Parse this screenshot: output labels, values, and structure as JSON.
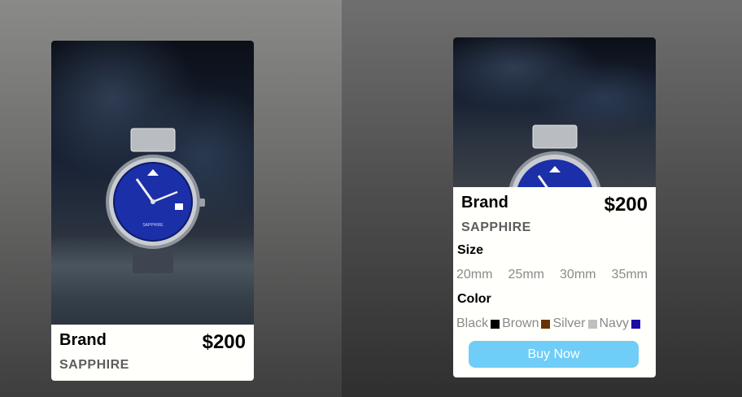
{
  "cards": [
    {
      "brand": "Brand",
      "price": "$200",
      "subtitle": "SAPPHIRE",
      "image_alt": "watch-image"
    },
    {
      "brand": "Brand",
      "price": "$200",
      "subtitle": "SAPPHIRE",
      "size_title": "Size",
      "sizes": [
        "20mm",
        "25mm",
        "30mm",
        "35mm"
      ],
      "color_title": "Color",
      "colors": [
        {
          "name": "Black",
          "hex": "#000000"
        },
        {
          "name": "Brown",
          "hex": "#6b3200"
        },
        {
          "name": "Silver",
          "hex": "#c0c0c0"
        },
        {
          "name": "Navy",
          "hex": "#1a0aa3"
        }
      ],
      "buy_label": "Buy Now",
      "buy_color": "#6fcdf7"
    }
  ],
  "watch": {
    "dial_text": "SAPPHIRE",
    "dial_color": "#1a2fa8"
  }
}
